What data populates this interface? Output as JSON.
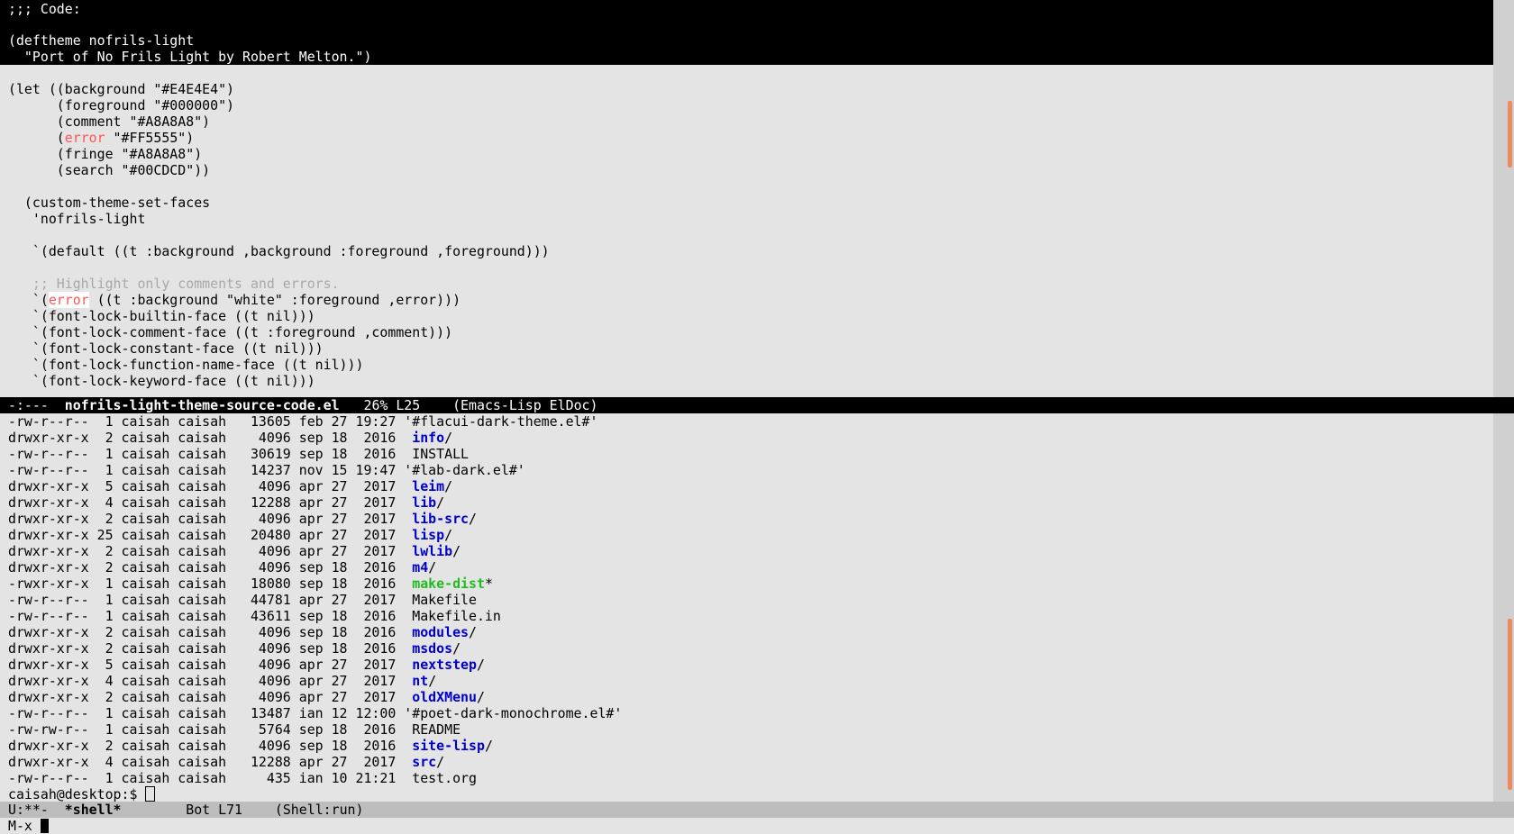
{
  "editor": {
    "header_lines": [
      ";;; Code:",
      "",
      "(deftheme nofrils-light",
      "  \"Port of No Frils Light by Robert Melton.\")"
    ],
    "let_open": "(let ((background \"#E4E4E4\")",
    "let_lines": [
      "      (foreground \"#000000\")",
      "      (comment \"#A8A8A8\")"
    ],
    "error_open": "      (",
    "error_word": "error",
    "error_rest": " \"#FF5555\")",
    "let_lines2": [
      "      (fringe \"#A8A8A8\")",
      "      (search \"#00CDCD\"))"
    ],
    "set_faces": "  (custom-theme-set-faces",
    "theme_name": "   'nofrils-light",
    "default_face": "   `(default ((t :background ,background :foreground ,foreground)))",
    "comment_line": "   ;; Highlight only comments and errors.",
    "error_face_open": "   `(",
    "error_face_word": "error",
    "error_face_rest": " ((t :background \"white\" :foreground ,error)))",
    "face_lines": [
      "   `(font-lock-builtin-face ((t nil)))",
      "   `(font-lock-comment-face ((t :foreground ,comment)))",
      "   `(font-lock-constant-face ((t nil)))",
      "   `(font-lock-function-name-face ((t nil)))",
      "   `(font-lock-keyword-face ((t nil)))"
    ]
  },
  "modeline_top": {
    "status": "-:---  ",
    "buffer": "nofrils-light-theme-source-code.el",
    "position": "   26% L25    ",
    "mode": "(Emacs-Lisp ElDoc)"
  },
  "shell": {
    "rows": [
      {
        "info": "-rw-r--r--  1 caisah caisah   13605 feb 27 19:27 ",
        "name": "'#flacui-dark-theme.el#'",
        "kind": "file",
        "suffix": ""
      },
      {
        "info": "drwxr-xr-x  2 caisah caisah    4096 sep 18  2016  ",
        "name": "info",
        "kind": "dir",
        "suffix": "/"
      },
      {
        "info": "-rw-r--r--  1 caisah caisah   30619 sep 18  2016  ",
        "name": "INSTALL",
        "kind": "file",
        "suffix": ""
      },
      {
        "info": "-rw-r--r--  1 caisah caisah   14237 nov 15 19:47 ",
        "name": "'#lab-dark.el#'",
        "kind": "file",
        "suffix": ""
      },
      {
        "info": "drwxr-xr-x  5 caisah caisah    4096 apr 27  2017  ",
        "name": "leim",
        "kind": "dir",
        "suffix": "/"
      },
      {
        "info": "drwxr-xr-x  4 caisah caisah   12288 apr 27  2017  ",
        "name": "lib",
        "kind": "dir",
        "suffix": "/"
      },
      {
        "info": "drwxr-xr-x  2 caisah caisah    4096 apr 27  2017  ",
        "name": "lib-src",
        "kind": "dir",
        "suffix": "/"
      },
      {
        "info": "drwxr-xr-x 25 caisah caisah   20480 apr 27  2017  ",
        "name": "lisp",
        "kind": "dir",
        "suffix": "/"
      },
      {
        "info": "drwxr-xr-x  2 caisah caisah    4096 apr 27  2017  ",
        "name": "lwlib",
        "kind": "dir",
        "suffix": "/"
      },
      {
        "info": "drwxr-xr-x  2 caisah caisah    4096 sep 18  2016  ",
        "name": "m4",
        "kind": "dir",
        "suffix": "/"
      },
      {
        "info": "-rwxr-xr-x  1 caisah caisah   18080 sep 18  2016  ",
        "name": "make-dist",
        "kind": "exe",
        "suffix": "*"
      },
      {
        "info": "-rw-r--r--  1 caisah caisah   44781 apr 27  2017  ",
        "name": "Makefile",
        "kind": "file",
        "suffix": ""
      },
      {
        "info": "-rw-r--r--  1 caisah caisah   43611 sep 18  2016  ",
        "name": "Makefile.in",
        "kind": "file",
        "suffix": ""
      },
      {
        "info": "drwxr-xr-x  2 caisah caisah    4096 sep 18  2016  ",
        "name": "modules",
        "kind": "dir",
        "suffix": "/"
      },
      {
        "info": "drwxr-xr-x  2 caisah caisah    4096 sep 18  2016  ",
        "name": "msdos",
        "kind": "dir",
        "suffix": "/"
      },
      {
        "info": "drwxr-xr-x  5 caisah caisah    4096 apr 27  2017  ",
        "name": "nextstep",
        "kind": "dir",
        "suffix": "/"
      },
      {
        "info": "drwxr-xr-x  4 caisah caisah    4096 apr 27  2017  ",
        "name": "nt",
        "kind": "dir",
        "suffix": "/"
      },
      {
        "info": "drwxr-xr-x  2 caisah caisah    4096 apr 27  2017  ",
        "name": "oldXMenu",
        "kind": "dir",
        "suffix": "/"
      },
      {
        "info": "-rw-r--r--  1 caisah caisah   13487 ian 12 12:00 ",
        "name": "'#poet-dark-monochrome.el#'",
        "kind": "file",
        "suffix": ""
      },
      {
        "info": "-rw-rw-r--  1 caisah caisah    5764 sep 18  2016  ",
        "name": "README",
        "kind": "file",
        "suffix": ""
      },
      {
        "info": "drwxr-xr-x  2 caisah caisah    4096 sep 18  2016  ",
        "name": "site-lisp",
        "kind": "dir",
        "suffix": "/"
      },
      {
        "info": "drwxr-xr-x  4 caisah caisah   12288 apr 27  2017  ",
        "name": "src",
        "kind": "dir",
        "suffix": "/"
      },
      {
        "info": "-rw-r--r--  1 caisah caisah     435 ian 10 21:21  ",
        "name": "test.org",
        "kind": "file",
        "suffix": ""
      }
    ],
    "prompt": "caisah@desktop:$ "
  },
  "modeline_bottom": {
    "status": "U:**-  ",
    "buffer": "*shell*",
    "position": "        Bot L71    ",
    "mode": "(Shell:run)"
  },
  "minibuffer": {
    "prompt": "M-x "
  },
  "colors": {
    "background": "#E4E4E4",
    "foreground": "#000000",
    "comment": "#A8A8A8",
    "error": "#FF5555",
    "directory": "#0000CC",
    "executable": "#22BB22",
    "scrollbar_thumb": "#F08A5D"
  }
}
